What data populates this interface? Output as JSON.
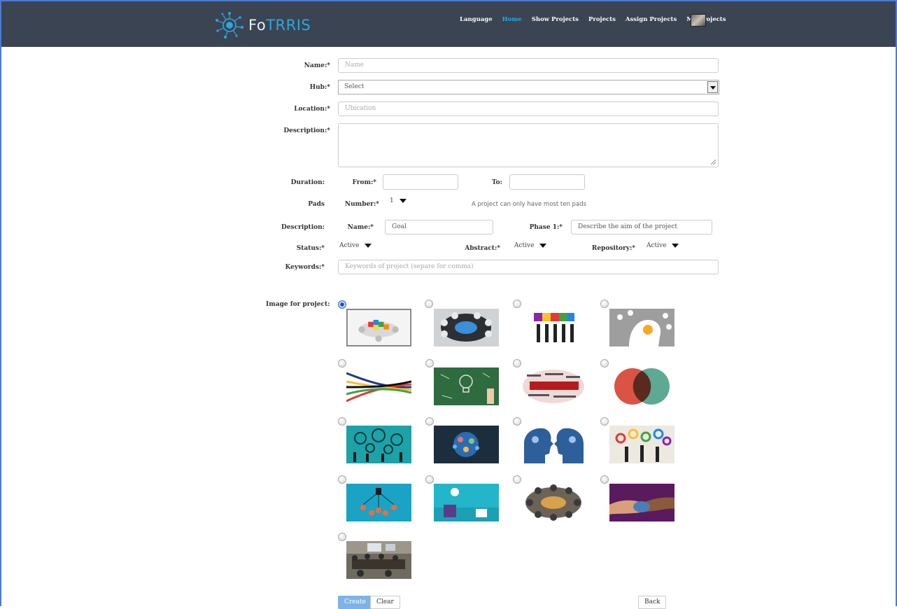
{
  "brand": {
    "name_fo": "Fo",
    "name_rest": "TRRIS"
  },
  "nav": {
    "items": [
      {
        "label": "Language",
        "active": false
      },
      {
        "label": "Home",
        "active": true
      },
      {
        "label": "Show Projects",
        "active": false
      },
      {
        "label": "Projects",
        "active": false
      },
      {
        "label": "Assign Projects",
        "active": false
      },
      {
        "label": "My Projects",
        "active": false
      }
    ]
  },
  "form": {
    "name": {
      "label": "Name:*",
      "placeholder": "Name"
    },
    "hub": {
      "label": "Hub:*",
      "value": "Select"
    },
    "location": {
      "label": "Location:*",
      "placeholder": "Ubication"
    },
    "description": {
      "label": "Description:*"
    },
    "duration": {
      "label": "Duration:",
      "from_label": "From:*",
      "to_label": "To:"
    },
    "pads": {
      "label": "Pads",
      "number_label": "Number:*",
      "number_value": "1",
      "hint": "A project can only have most ten pads"
    },
    "pad_description": {
      "label": "Description:",
      "name_label": "Name:*",
      "name_value": "Goal",
      "phase_label": "Phase 1:*",
      "phase_value": "Describe the aim of the project"
    },
    "status": {
      "label": "Status:*",
      "value": "Active"
    },
    "abstract": {
      "label": "Abstract:*",
      "value": "Active"
    },
    "repository": {
      "label": "Repository:*",
      "value": "Active"
    },
    "keywords": {
      "label": "Keywords:*",
      "placeholder": "Keywords of project (separe for comma)"
    },
    "image": {
      "label": "Image for project:",
      "selected_index": 0,
      "options": [
        "puzzle-meeting",
        "puzzle-hands-circle",
        "people-holding-puzzle",
        "head-ideas",
        "colored-ropes",
        "lightbulb-chalkboard",
        "collaboration-wordcloud",
        "me-us-you-venn",
        "gears-people",
        "globe-icons",
        "head-profiles-gears",
        "people-gears",
        "team-network",
        "idea-team",
        "people-circle-aerial",
        "holding-hands",
        "meeting-room-photo"
      ]
    }
  },
  "actions": {
    "create": "Create",
    "clear": "Clear",
    "back": "Back"
  }
}
